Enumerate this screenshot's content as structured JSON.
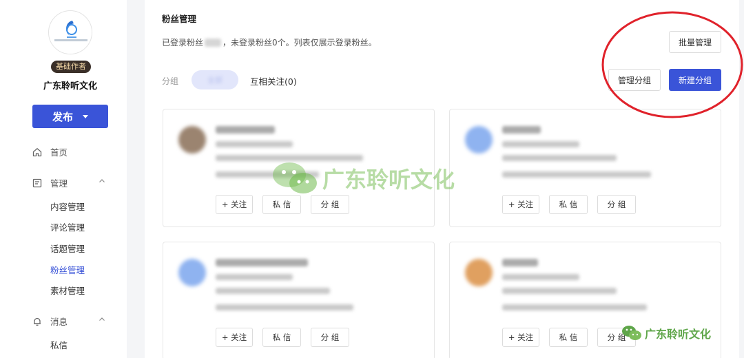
{
  "sidebar": {
    "badge": "基础作者",
    "account_name": "广东聆听文化",
    "publish_label": "发布",
    "nav": {
      "home": "首页",
      "manage": "管理",
      "manage_items": [
        "内容管理",
        "评论管理",
        "话题管理",
        "粉丝管理",
        "素材管理"
      ],
      "messages": "消息",
      "message_items": [
        "私信"
      ]
    }
  },
  "main": {
    "title": "粉丝管理",
    "notice_prefix": "已登录粉丝",
    "notice_suffix": "，未登录粉丝0个。列表仅展示登录粉丝。",
    "bulk_manage": "批量管理",
    "group_label": "分组",
    "group_pill": "全部",
    "mutual_follow": "互相关注(0)",
    "manage_groups": "管理分组",
    "new_group": "新建分组",
    "card_actions": {
      "follow": "+ 关注",
      "message": "私 信",
      "group": "分 组"
    }
  },
  "watermark": "广东聆听文化",
  "colors": {
    "accent": "#3a54d8",
    "annotation_red": "#e0222b",
    "badge_bg": "#3a2f28"
  }
}
